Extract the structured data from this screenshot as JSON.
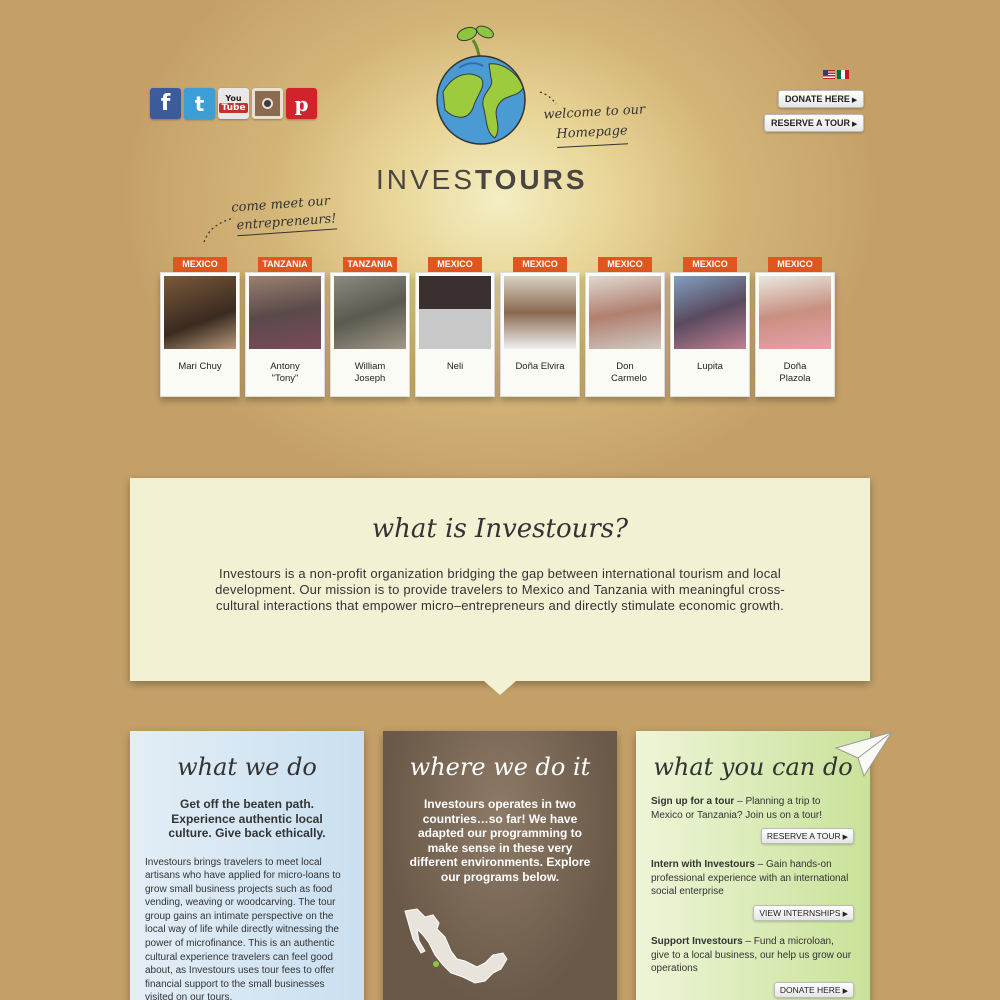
{
  "header": {
    "social": [
      "f",
      "t",
      "You",
      "Tube",
      "",
      "p"
    ],
    "donate_label": "DONATE HERE",
    "reserve_label": "RESERVE A TOUR",
    "welcome_line1": "welcome to our",
    "welcome_line2": "Homepage",
    "logo_light": "INVES",
    "logo_bold": "TOURS",
    "come_line1": "come meet our",
    "come_line2": "entrepreneurs!"
  },
  "entrepreneurs": [
    {
      "country": "MEXICO",
      "name": "Mari Chuy"
    },
    {
      "country": "TANZANIA",
      "name": "Antony \"Tony\""
    },
    {
      "country": "TANZANIA",
      "name": "William Joseph"
    },
    {
      "country": "MEXICO",
      "name": "Neli"
    },
    {
      "country": "MEXICO",
      "name": "Doña Elvira"
    },
    {
      "country": "MEXICO",
      "name": "Don Carmelo"
    },
    {
      "country": "MEXICO",
      "name": "Lupita"
    },
    {
      "country": "MEXICO",
      "name": "Doña Plazola"
    }
  ],
  "whatis": {
    "title": "what is Investours?",
    "text": "Investours is a non-profit organization bridging the gap between international tourism and local development. Our mission is to provide travelers to Mexico and Tanzania with meaningful cross-cultural interactions that empower micro–entrepreneurs and directly stimulate economic growth."
  },
  "what_we_do": {
    "title": "what we do",
    "lead": "Get off the beaten path. Experience authentic local culture. Give back ethically.",
    "text": "Investours brings travelers to meet local artisans who have applied for micro-loans to grow small business projects such as food vending, weaving or woodcarving. The tour group gains an intimate perspective on the local way of life while directly witnessing the power of microfinance. This is an authentic cultural experience travelers can feel good about, as Investours uses tour fees to offer financial support to the small businesses visited on our tours."
  },
  "where_we_do_it": {
    "title": "where we do it",
    "lead": "Investours operates in two countries…so far! We have adapted our programming to make sense in these very different environments. Explore our programs below."
  },
  "what_you_can_do": {
    "title": "what you can do",
    "items": [
      {
        "bold": "Sign up for a tour",
        "text": " – Planning a trip to Mexico or Tanzania? Join us on a tour!",
        "button": "RESERVE A TOUR"
      },
      {
        "bold": "Intern with Investours",
        "text": " – Gain hands-on professional experience with an international social enterprise",
        "button": "VIEW INTERNSHIPS"
      },
      {
        "bold": "Support Investours",
        "text": " – Fund a microloan, give to a local business, our help us grow our operations",
        "button": "DONATE HERE"
      }
    ]
  },
  "colors": {
    "accent": "#e0561f",
    "background": "#c4a068"
  }
}
